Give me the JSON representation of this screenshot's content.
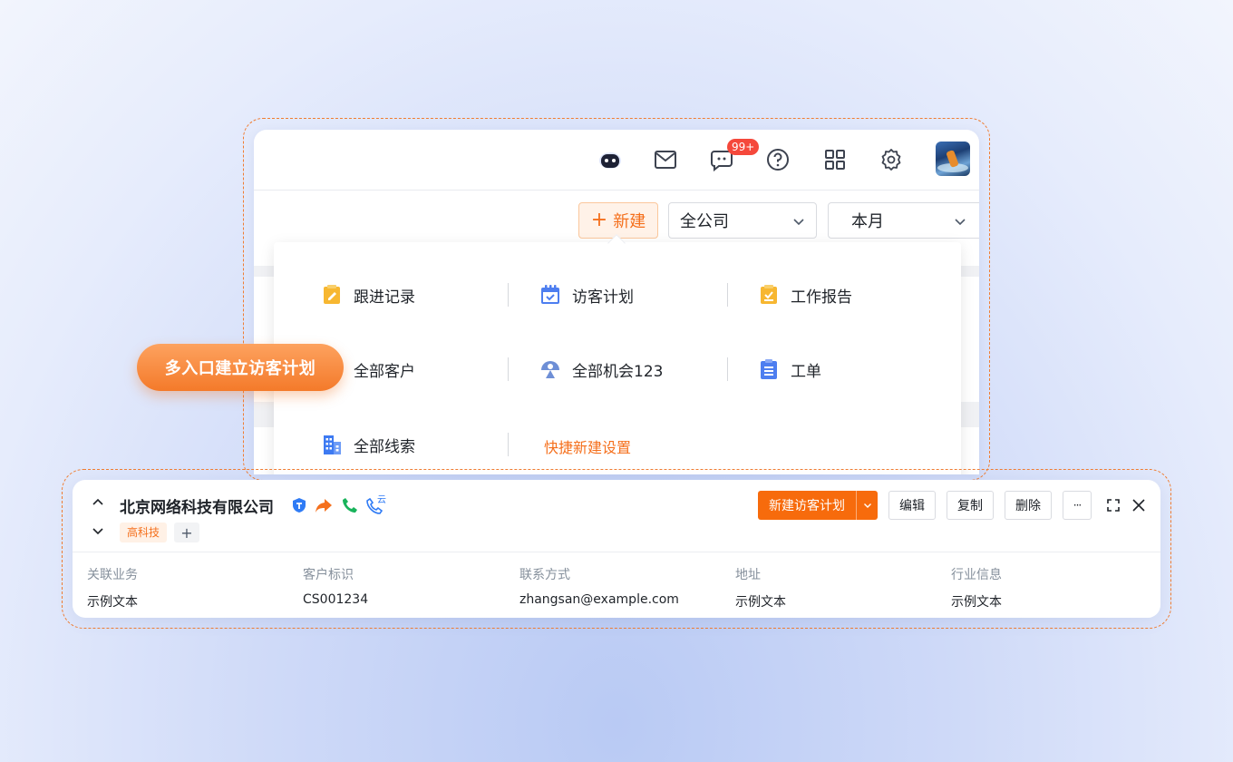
{
  "header": {
    "message_badge": "99+"
  },
  "toolbar": {
    "new_label": "新建",
    "scope_value": "全公司",
    "period_value": "本月"
  },
  "new_menu": {
    "items": [
      {
        "label": "跟进记录",
        "icon": "followup-note-icon"
      },
      {
        "label": "访客计划",
        "icon": "visit-plan-calendar-icon"
      },
      {
        "label": "工作报告",
        "icon": "work-report-icon"
      },
      {
        "label": "全部客户",
        "icon": "customer-icon"
      },
      {
        "label": "全部机会123",
        "icon": "opportunity-icon"
      },
      {
        "label": "工单",
        "icon": "work-order-clipboard-icon"
      },
      {
        "label": "全部线索",
        "icon": "building-lead-icon"
      }
    ],
    "settings_link": "快捷新建设置"
  },
  "callout": "多入口建立访客计划",
  "record": {
    "company_name": "北京网络科技有限公司",
    "tag": "高科技",
    "tag_add": "+",
    "cloud_call_label": "云",
    "primary_action": "新建访客计划",
    "actions": [
      "编辑",
      "复制",
      "删除"
    ],
    "more": "···",
    "fields": [
      {
        "label": "关联业务",
        "value": "示例文本"
      },
      {
        "label": "客户标识",
        "value": "CS001234"
      },
      {
        "label": "联系方式",
        "value": "zhangsan@example.com"
      },
      {
        "label": "地址",
        "value": "示例文本"
      },
      {
        "label": "行业信息",
        "value": "示例文本"
      }
    ]
  },
  "colors": {
    "accent": "#f76b0c",
    "frame_dash": "#f07d32",
    "badge_red": "#f5483b",
    "icon_blue": "#2f7bf5",
    "icon_yellow": "#f7b731",
    "phone_green": "#19b35b"
  }
}
